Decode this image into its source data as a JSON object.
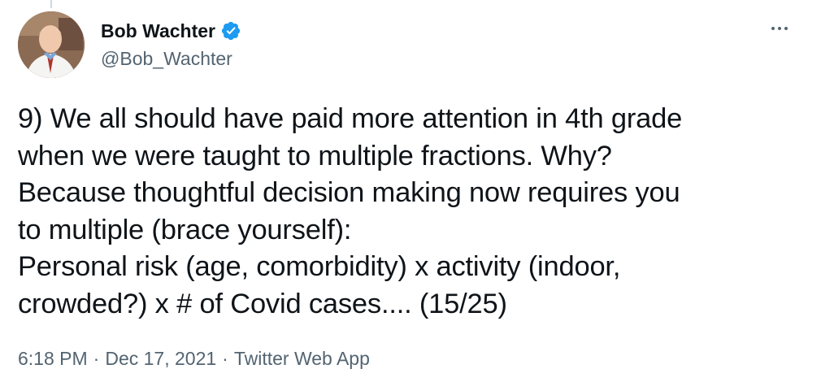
{
  "author": {
    "display_name": "Bob Wachter",
    "handle": "@Bob_Wachter",
    "verified": true
  },
  "tweet": {
    "text": "9) We all should have paid more attention in 4th grade\nwhen we were taught to multiple fractions. Why?\nBecause thoughtful decision making now requires you\nto multiple (brace yourself):\nPersonal risk (age, comorbidity) x activity (indoor,\ncrowded?) x # of Covid cases.... (15/25)"
  },
  "meta": {
    "time": "6:18 PM",
    "separator": "·",
    "date": "Dec 17, 2021",
    "source": "Twitter Web App"
  },
  "icons": {
    "verified": "verified-badge-icon",
    "more": "more-options-icon"
  },
  "colors": {
    "text_primary": "#0f1419",
    "text_secondary": "#536471",
    "verified_blue": "#1d9bf0",
    "thread_line": "#cfd9de"
  }
}
